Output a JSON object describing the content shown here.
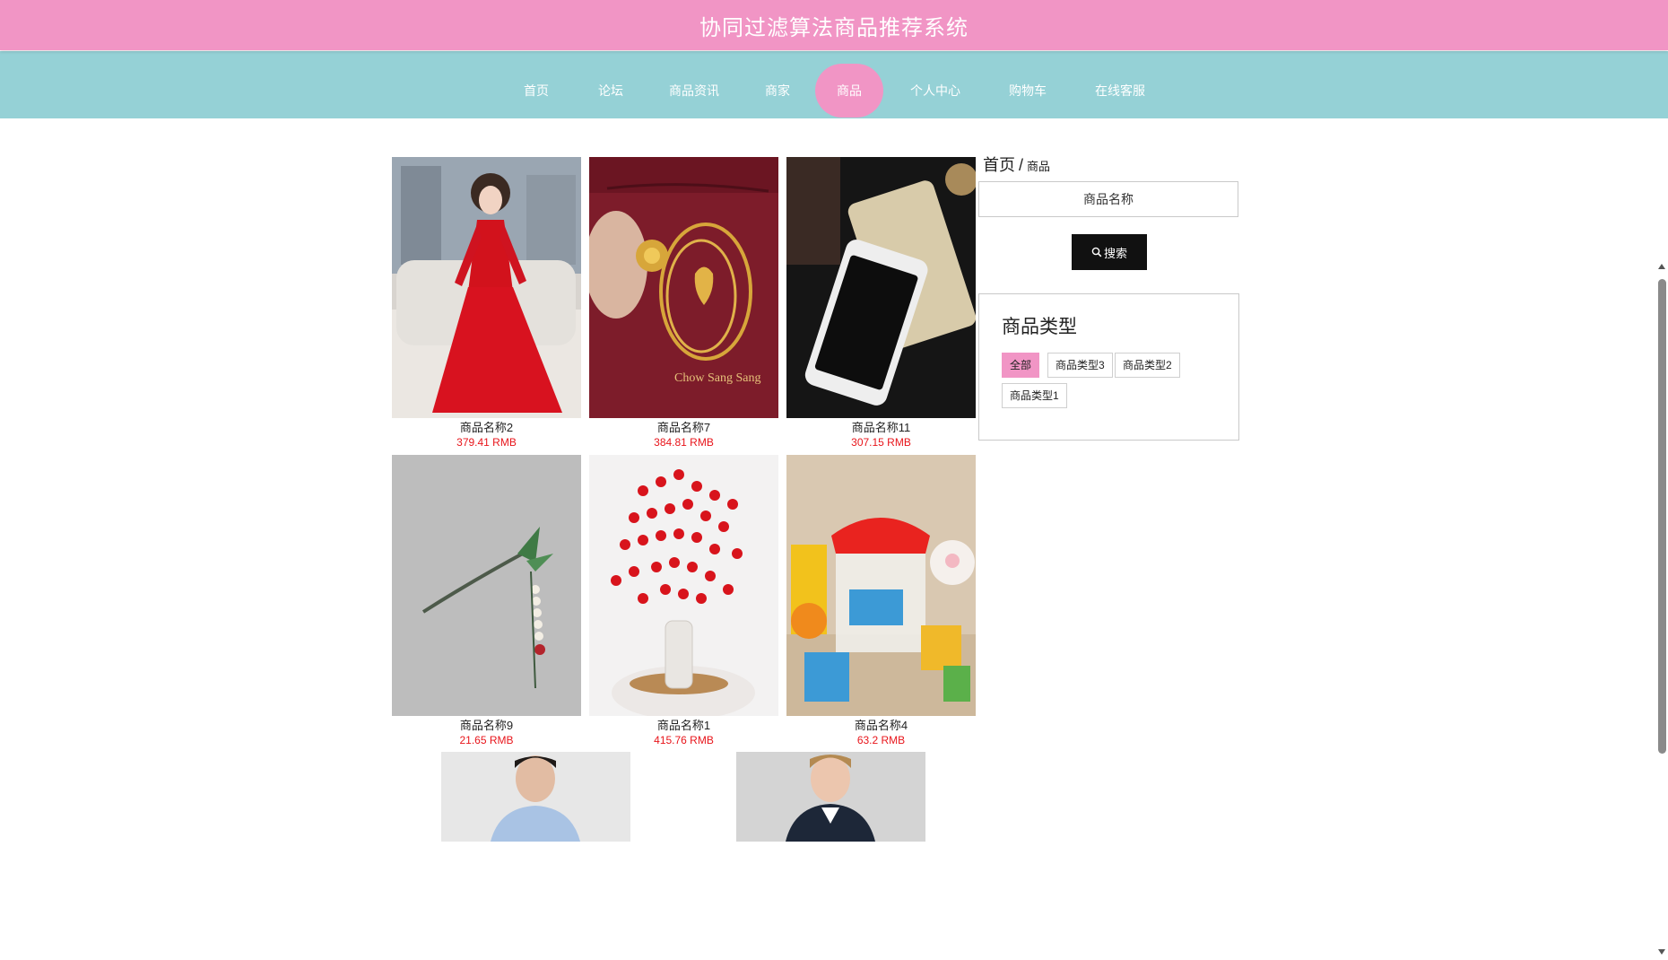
{
  "header": {
    "title": "协同过滤算法商品推荐系统"
  },
  "nav": {
    "items": [
      {
        "label": "首页",
        "active": false
      },
      {
        "label": "论坛",
        "active": false
      },
      {
        "label": "商品资讯",
        "active": false
      },
      {
        "label": "商家",
        "active": false
      },
      {
        "label": "商品",
        "active": true
      },
      {
        "label": "个人中心",
        "active": false
      },
      {
        "label": "购物车",
        "active": false
      },
      {
        "label": "在线客服",
        "active": false
      }
    ]
  },
  "breadcrumb": {
    "home": "首页",
    "separator": "/",
    "current": "商品"
  },
  "search": {
    "placeholder": "商品名称",
    "button_label": "搜索"
  },
  "types": {
    "title": "商品类型",
    "chips": [
      {
        "label": "全部",
        "active": true
      },
      {
        "label": "商品类型3",
        "active": false
      },
      {
        "label": "商品类型2",
        "active": false
      },
      {
        "label": "商品类型1",
        "active": false
      }
    ]
  },
  "products": [
    {
      "name": "商品名称2",
      "price": "379.41 RMB",
      "image": "red-dress-photo"
    },
    {
      "name": "商品名称7",
      "price": "384.81 RMB",
      "image": "gold-jewelry-photo"
    },
    {
      "name": "商品名称11",
      "price": "307.15 RMB",
      "image": "smartphone-photo"
    },
    {
      "name": "商品名称9",
      "price": "21.65 RMB",
      "image": "hairpin-photo"
    },
    {
      "name": "商品名称1",
      "price": "415.76 RMB",
      "image": "red-flowers-photo"
    },
    {
      "name": "商品名称4",
      "price": "63.2 RMB",
      "image": "food-container-photo"
    },
    {
      "name": "",
      "price": "",
      "image": "man-shirt-photo"
    },
    {
      "name": "",
      "price": "",
      "image": "man-jacket-photo"
    }
  ],
  "colors": {
    "brand_pink": "#f195c5",
    "nav_teal": "#95d1d6",
    "price_red": "#e8151b"
  }
}
